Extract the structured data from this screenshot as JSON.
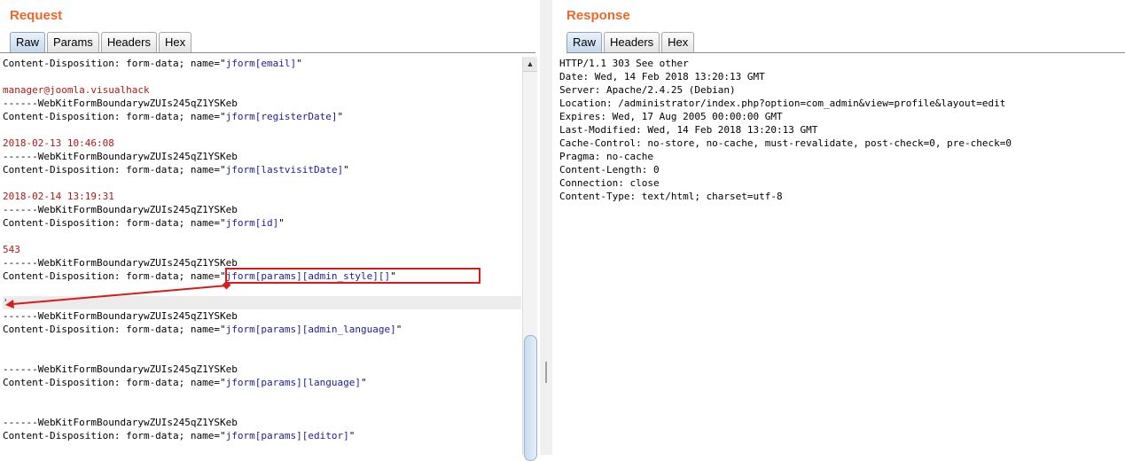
{
  "request": {
    "title": "Request",
    "tabs": [
      "Raw",
      "Params",
      "Headers",
      "Hex"
    ],
    "active_tab": "Raw",
    "lines": [
      {
        "k": "Content-Disposition: form-data; name=\"",
        "v": "jform[email]",
        "t": "\""
      },
      {
        "k": "",
        "v": "",
        "t": ""
      },
      {
        "k": "",
        "r": "manager@joomla.visualhack"
      },
      {
        "k": "------WebKitFormBoundarywZUIs245qZ1YSKeb"
      },
      {
        "k": "Content-Disposition: form-data; name=\"",
        "v": "jform[registerDate]",
        "t": "\""
      },
      {
        "k": "",
        "v": "",
        "t": ""
      },
      {
        "k": "",
        "r": "2018-02-13 10:46:08"
      },
      {
        "k": "------WebKitFormBoundarywZUIs245qZ1YSKeb"
      },
      {
        "k": "Content-Disposition: form-data; name=\"",
        "v": "jform[lastvisitDate]",
        "t": "\""
      },
      {
        "k": "",
        "v": "",
        "t": ""
      },
      {
        "k": "",
        "r": "2018-02-14 13:19:31"
      },
      {
        "k": "------WebKitFormBoundarywZUIs245qZ1YSKeb"
      },
      {
        "k": "Content-Disposition: form-data; name=\"",
        "v": "jform[id]",
        "t": "\""
      },
      {
        "k": "",
        "v": "",
        "t": ""
      },
      {
        "k": "",
        "r": "543"
      },
      {
        "k": "------WebKitFormBoundarywZUIs245qZ1YSKeb"
      },
      {
        "k": "Content-Disposition: form-data; name=\"",
        "v": "jform[params][admin_style][]",
        "t": "\""
      },
      {
        "k": "",
        "v": "",
        "t": ""
      },
      {
        "k": "",
        "r": "'",
        "hl": true
      },
      {
        "k": "------WebKitFormBoundarywZUIs245qZ1YSKeb"
      },
      {
        "k": "Content-Disposition: form-data; name=\"",
        "v": "jform[params][admin_language]",
        "t": "\""
      },
      {
        "k": "",
        "v": "",
        "t": ""
      },
      {
        "k": "",
        "v": "",
        "t": ""
      },
      {
        "k": "------WebKitFormBoundarywZUIs245qZ1YSKeb"
      },
      {
        "k": "Content-Disposition: form-data; name=\"",
        "v": "jform[params][language]",
        "t": "\""
      },
      {
        "k": "",
        "v": "",
        "t": ""
      },
      {
        "k": "",
        "v": "",
        "t": ""
      },
      {
        "k": "------WebKitFormBoundarywZUIs245qZ1YSKeb"
      },
      {
        "k": "Content-Disposition: form-data; name=\"",
        "v": "jform[params][editor]",
        "t": "\""
      }
    ]
  },
  "response": {
    "title": "Response",
    "tabs": [
      "Raw",
      "Headers",
      "Hex"
    ],
    "active_tab": "Raw",
    "lines": [
      "HTTP/1.1 303 See other",
      "Date: Wed, 14 Feb 2018 13:20:13 GMT",
      "Server: Apache/2.4.25 (Debian)",
      "Location: /administrator/index.php?option=com_admin&view=profile&layout=edit",
      "Expires: Wed, 17 Aug 2005 00:00:00 GMT",
      "Last-Modified: Wed, 14 Feb 2018 13:20:13 GMT",
      "Cache-Control: no-store, no-cache, must-revalidate, post-check=0, pre-check=0",
      "Pragma: no-cache",
      "Content-Length: 0",
      "Connection: close",
      "Content-Type: text/html; charset=utf-8"
    ]
  },
  "colors": {
    "title": "#e8692b",
    "value": "#1b1b9a",
    "red_text": "#b01717",
    "annotation": "#d81b1b"
  },
  "icons": {
    "scroll_up": "triangle-up-icon"
  }
}
